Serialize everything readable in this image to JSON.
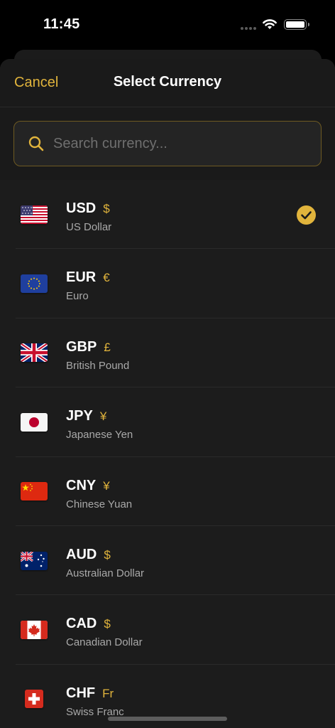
{
  "status_bar": {
    "time": "11:45"
  },
  "header": {
    "cancel_label": "Cancel",
    "title": "Select Currency"
  },
  "search": {
    "placeholder": "Search currency..."
  },
  "colors": {
    "accent": "#e1b43c",
    "background": "#1c1c1c"
  },
  "currencies": [
    {
      "code": "USD",
      "symbol": "$",
      "name": "US Dollar",
      "flag": "us-flag",
      "selected": true
    },
    {
      "code": "EUR",
      "symbol": "€",
      "name": "Euro",
      "flag": "eu-flag",
      "selected": false
    },
    {
      "code": "GBP",
      "symbol": "£",
      "name": "British Pound",
      "flag": "gb-flag",
      "selected": false
    },
    {
      "code": "JPY",
      "symbol": "¥",
      "name": "Japanese Yen",
      "flag": "jp-flag",
      "selected": false
    },
    {
      "code": "CNY",
      "symbol": "¥",
      "name": "Chinese Yuan",
      "flag": "cn-flag",
      "selected": false
    },
    {
      "code": "AUD",
      "symbol": "$",
      "name": "Australian Dollar",
      "flag": "au-flag",
      "selected": false
    },
    {
      "code": "CAD",
      "symbol": "$",
      "name": "Canadian Dollar",
      "flag": "ca-flag",
      "selected": false
    },
    {
      "code": "CHF",
      "symbol": "Fr",
      "name": "Swiss Franc",
      "flag": "ch-flag",
      "selected": false
    }
  ]
}
